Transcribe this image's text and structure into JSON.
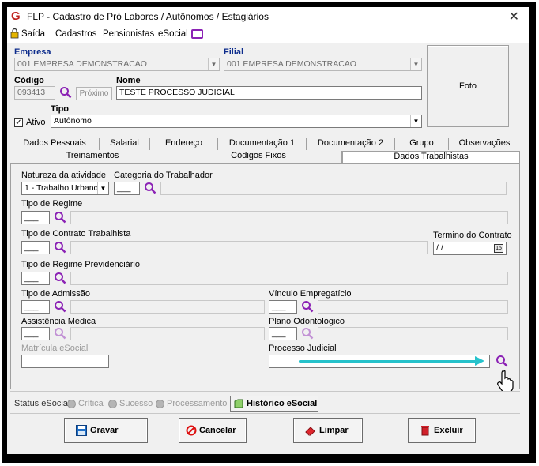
{
  "title": "FLP - Cadastro de Pró Labores / Autônomos / Estagiários",
  "menu": {
    "saida": "Saída",
    "cadastros": "Cadastros",
    "pensionistas": "Pensionistas",
    "esocial": "eSocial"
  },
  "header": {
    "empresa_label": "Empresa",
    "empresa_value": "001 EMPRESA DEMONSTRACAO",
    "filial_label": "Filial",
    "filial_value": "001 EMPRESA DEMONSTRACAO",
    "codigo_label": "Código",
    "codigo_value": "093413",
    "proximo_label": "Próximo",
    "nome_label": "Nome",
    "nome_value": "TESTE PROCESSO JUDICIAL",
    "ativo_label": "Ativo",
    "ativo_checked": true,
    "check_mark": "✓",
    "tipo_label": "Tipo",
    "tipo_value": "Autônomo",
    "foto_label": "Foto"
  },
  "tabs_row1": [
    "Dados Pessoais",
    "Salarial",
    "Endereço",
    "Documentação 1",
    "Documentação 2",
    "Grupo",
    "Observações"
  ],
  "tabs_row2": [
    "Treinamentos",
    "Códigos Fixos",
    "Dados Trabalhistas"
  ],
  "active_tab": "Dados Trabalhistas",
  "form": {
    "natureza_label": "Natureza da atividade",
    "natureza_value": "1 - Trabalho Urbano",
    "categoria_label": "Categoria do Trabalhador",
    "categoria_code": "___",
    "tipo_regime_label": "Tipo de Regime",
    "tipo_regime_code": "___",
    "tipo_contrato_label": "Tipo de Contrato Trabalhista",
    "tipo_contrato_code": "___",
    "termino_label": "Termino do Contrato",
    "termino_value": " / /",
    "calendar_day": "15",
    "regime_prev_label": "Tipo de Regime Previdenciário",
    "regime_prev_code": "___",
    "tipo_admissao_label": "Tipo de Admissão",
    "tipo_admissao_code": "___",
    "vinculo_label": "Vínculo Empregatício",
    "vinculo_code": "___",
    "assistencia_label": "Assistência Médica",
    "assistencia_code": "___",
    "plano_odonto_label": "Plano Odontológico",
    "plano_odonto_code": "___",
    "matricula_label": "Matrícula eSocial",
    "matricula_value": "",
    "processo_label": "Processo Judicial",
    "processo_value": ""
  },
  "status": {
    "label": "Status eSocial:",
    "critica": "Crítica",
    "sucesso": "Sucesso",
    "processamento": "Processamento",
    "historico_button": "Histórico eSocial"
  },
  "buttons": {
    "gravar": "Gravar",
    "cancelar": "Cancelar",
    "limpar": "Limpar",
    "excluir": "Excluir"
  },
  "colors": {
    "accent_magenta": "#8b22b5",
    "annotation_arrow": "#27c3cc",
    "label_blue": "#0d2c8c",
    "logo_red": "#c0221e"
  }
}
